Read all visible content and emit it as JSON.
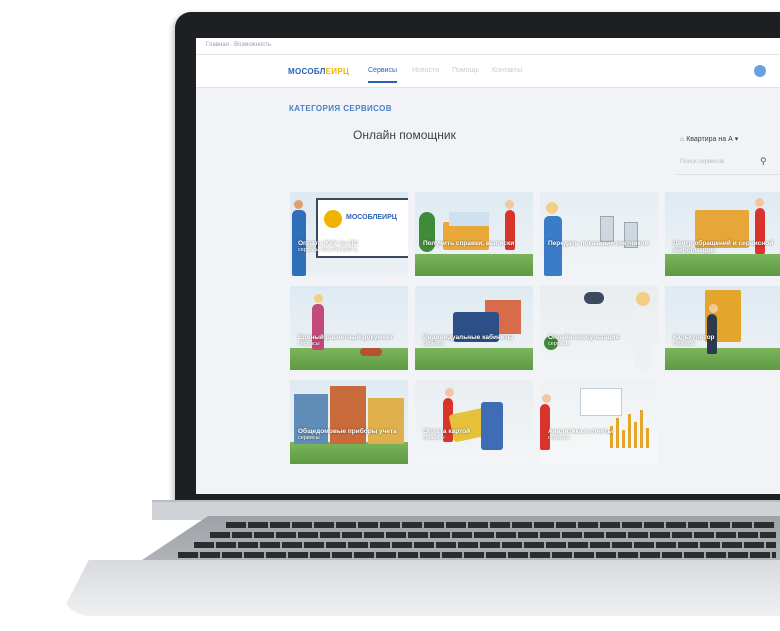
{
  "header": {
    "breadcrumb": "Главная · Возможность",
    "logo_text_1": "МОСОБЛ",
    "logo_text_2": "ЕИРЦ",
    "nav_items": [
      "Сервисы",
      "Новости",
      "Помощь",
      "Контакты"
    ]
  },
  "main": {
    "category_label": "КАТЕГОРИЯ СЕРВИСОВ",
    "title": "Онлайн помощник",
    "filter_label": "Квартира на А",
    "search_placeholder": "Поиск сервисов"
  },
  "tiles": [
    {
      "label": "Оплата ЖКУ по ЛС",
      "sub": "сервисы МосОблЕИРЦ"
    },
    {
      "label": "Получить справки, выписки",
      "sub": ""
    },
    {
      "label": "Передать показания счетчиков",
      "sub": ""
    },
    {
      "label": "Центр обращений и сервисной информации",
      "sub": ""
    },
    {
      "label": "Единый расчетный документ",
      "sub": "сервисы"
    },
    {
      "label": "Индивидуальные кабинеты",
      "sub": "сервисы"
    },
    {
      "label": "Онлайн-консультация",
      "sub": "сервисы"
    },
    {
      "label": "Калькулятор",
      "sub": "сервисы"
    },
    {
      "label": "Общедомовые приборы учета",
      "sub": "сервисы"
    },
    {
      "label": "Оплата картой",
      "sub": "сервисы"
    },
    {
      "label": "Аналитика и отчеты",
      "sub": "сервисы"
    }
  ],
  "colors": {
    "brand_blue": "#2a63b5",
    "brand_yellow": "#f0b400",
    "laptop_bezel": "#1d1f22"
  }
}
